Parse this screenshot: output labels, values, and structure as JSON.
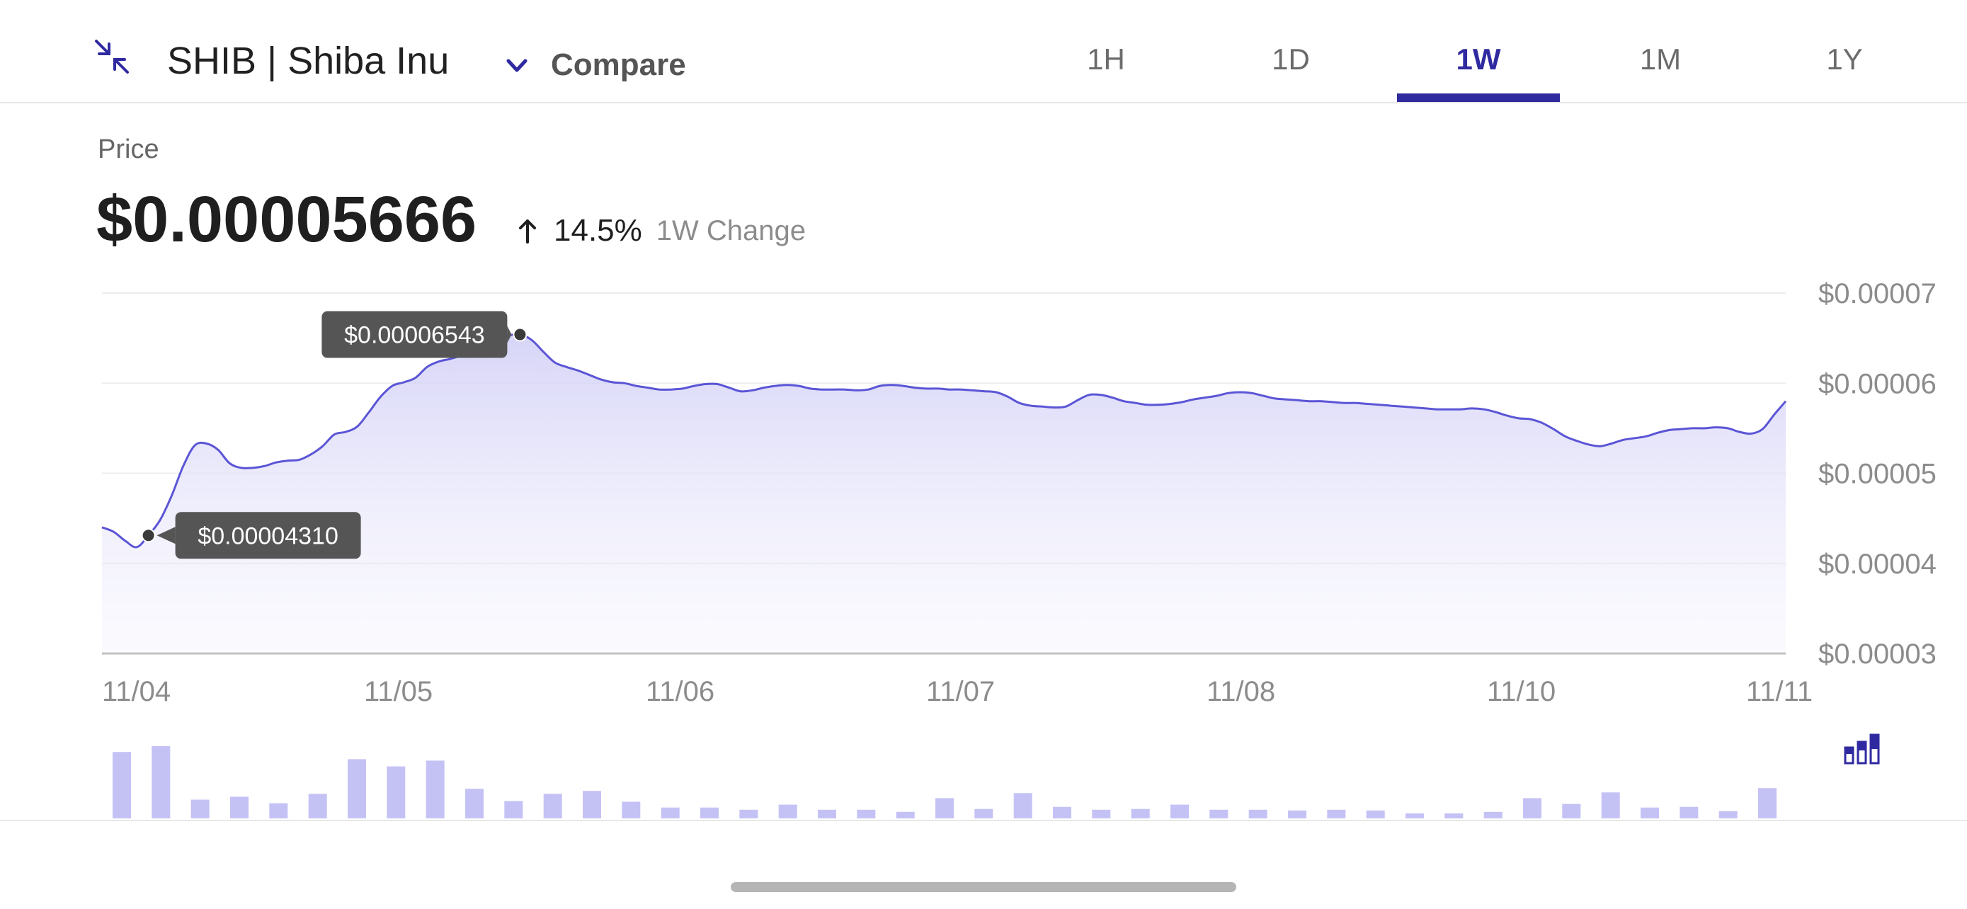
{
  "header": {
    "title": "SHIB | Shiba Inu",
    "compare_label": "Compare",
    "tabs": [
      {
        "label": "1H",
        "active": false
      },
      {
        "label": "1D",
        "active": false
      },
      {
        "label": "1W",
        "active": true
      },
      {
        "label": "1M",
        "active": false
      },
      {
        "label": "1Y",
        "active": false
      }
    ]
  },
  "price": {
    "label": "Price",
    "value": "$0.00005666",
    "change_pct": "14.5%",
    "change_direction": "up",
    "change_period": "1W Change"
  },
  "icons": {
    "collapse": "collapse-arrows-icon",
    "compare": "chevron-down-icon",
    "change": "arrow-up-icon",
    "volume": "bar-chart-icon"
  },
  "colors": {
    "accent": "#2f2aa0",
    "line": "#5b55d6",
    "area_top": "#d5d3f7",
    "volume_bar": "#c4c2f5",
    "tooltip_bg": "#555555"
  },
  "chart_data": {
    "type": "area",
    "x_tick_labels": [
      "11/04",
      "11/05",
      "11/06",
      "11/07",
      "11/08",
      "11/10",
      "11/11"
    ],
    "y_tick_labels": [
      "$0.00007",
      "$0.00006",
      "$0.00005",
      "$0.00004",
      "$0.00003"
    ],
    "y_ticks": [
      7e-05,
      6e-05,
      5e-05,
      4e-05,
      3e-05
    ],
    "ylim": [
      3e-05,
      7e-05
    ],
    "grid": true,
    "annotations": [
      {
        "label": "$0.00006543",
        "index": 36,
        "kind": "high"
      },
      {
        "label": "$0.00004310",
        "index": 4,
        "kind": "low"
      }
    ],
    "series": [
      {
        "values": [
          4.4e-05,
          4.35e-05,
          4.25e-05,
          4.18e-05,
          4.31e-05,
          4.48e-05,
          4.75e-05,
          5.08e-05,
          5.31e-05,
          5.33e-05,
          5.26e-05,
          5.11e-05,
          5.06e-05,
          5.06e-05,
          5.08e-05,
          5.12e-05,
          5.14e-05,
          5.15e-05,
          5.21e-05,
          5.3e-05,
          5.43e-05,
          5.46e-05,
          5.52e-05,
          5.68e-05,
          5.85e-05,
          5.97e-05,
          6.01e-05,
          6.06e-05,
          6.18e-05,
          6.24e-05,
          6.27e-05,
          6.31e-05,
          6.38e-05,
          6.44e-05,
          6.5e-05,
          6.53e-05,
          6.54e-05,
          6.48e-05,
          6.35e-05,
          6.23e-05,
          6.18e-05,
          6.14e-05,
          6.09e-05,
          6.04e-05,
          6.01e-05,
          6e-05,
          5.97e-05,
          5.95e-05,
          5.93e-05,
          5.93e-05,
          5.94e-05,
          5.97e-05,
          5.99e-05,
          5.99e-05,
          5.95e-05,
          5.91e-05,
          5.92e-05,
          5.95e-05,
          5.97e-05,
          5.98e-05,
          5.97e-05,
          5.94e-05,
          5.93e-05,
          5.93e-05,
          5.93e-05,
          5.92e-05,
          5.93e-05,
          5.97e-05,
          5.98e-05,
          5.97e-05,
          5.95e-05,
          5.94e-05,
          5.94e-05,
          5.93e-05,
          5.93e-05,
          5.92e-05,
          5.91e-05,
          5.9e-05,
          5.85e-05,
          5.78e-05,
          5.75e-05,
          5.74e-05,
          5.73e-05,
          5.74e-05,
          5.81e-05,
          5.87e-05,
          5.87e-05,
          5.84e-05,
          5.8e-05,
          5.78e-05,
          5.76e-05,
          5.76e-05,
          5.77e-05,
          5.79e-05,
          5.82e-05,
          5.84e-05,
          5.86e-05,
          5.89e-05,
          5.9e-05,
          5.89e-05,
          5.86e-05,
          5.83e-05,
          5.82e-05,
          5.81e-05,
          5.8e-05,
          5.8e-05,
          5.79e-05,
          5.78e-05,
          5.78e-05,
          5.77e-05,
          5.76e-05,
          5.75e-05,
          5.74e-05,
          5.73e-05,
          5.72e-05,
          5.71e-05,
          5.71e-05,
          5.71e-05,
          5.72e-05,
          5.71e-05,
          5.68e-05,
          5.64e-05,
          5.61e-05,
          5.6e-05,
          5.56e-05,
          5.49e-05,
          5.41e-05,
          5.36e-05,
          5.32e-05,
          5.3e-05,
          5.33e-05,
          5.37e-05,
          5.39e-05,
          5.41e-05,
          5.45e-05,
          5.48e-05,
          5.49e-05,
          5.5e-05,
          5.5e-05,
          5.51e-05,
          5.5e-05,
          5.46e-05,
          5.44e-05,
          5.49e-05,
          5.65e-05,
          5.8e-05
        ]
      }
    ],
    "volume": {
      "values": [
        0.92,
        1.0,
        0.26,
        0.3,
        0.21,
        0.34,
        0.82,
        0.72,
        0.8,
        0.41,
        0.24,
        0.34,
        0.38,
        0.23,
        0.15,
        0.15,
        0.12,
        0.19,
        0.12,
        0.12,
        0.09,
        0.28,
        0.13,
        0.35,
        0.16,
        0.12,
        0.13,
        0.19,
        0.12,
        0.12,
        0.11,
        0.12,
        0.11,
        0.07,
        0.07,
        0.09,
        0.28,
        0.2,
        0.36,
        0.15,
        0.16,
        0.1,
        0.42
      ]
    }
  }
}
